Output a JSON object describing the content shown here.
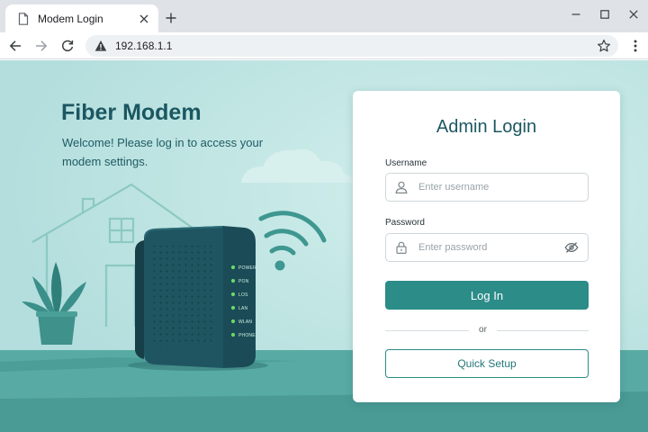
{
  "browser": {
    "tab_title": "Modem Login",
    "url": "192.168.1.1",
    "icons": {
      "tab": "page-icon",
      "tab_close": "close-icon",
      "new_tab": "plus-icon",
      "back": "arrow-left-icon",
      "forward": "arrow-right-icon",
      "reload": "reload-icon",
      "security": "warning-icon",
      "bookmark": "star-icon",
      "menu": "more-vert-icon",
      "window": [
        "minimize-icon",
        "maximize-icon",
        "close-icon"
      ]
    }
  },
  "hero": {
    "title": "Fiber Modem",
    "subtitle": "Welcome! Please log in to access your modem settings."
  },
  "modem": {
    "leds": [
      "POWER",
      "PON",
      "LOS",
      "LAN",
      "WLAN",
      "PHONE"
    ],
    "led_color": "#6cd86a"
  },
  "login": {
    "title": "Admin Login",
    "username_label": "Username",
    "username_placeholder": "Enter username",
    "username_value": "",
    "password_label": "Password",
    "password_placeholder": "Enter password",
    "password_value": "",
    "login_button": "Log In",
    "divider_text": "or",
    "quick_setup_button": "Quick Setup",
    "icons": {
      "username": "user-icon",
      "password": "lock-icon",
      "toggle": "eye-off-icon"
    }
  },
  "colors": {
    "accent": "#2b8c88",
    "heading": "#1b5762",
    "page_background": "#b3dedd",
    "modem_body": "#1f5560"
  }
}
